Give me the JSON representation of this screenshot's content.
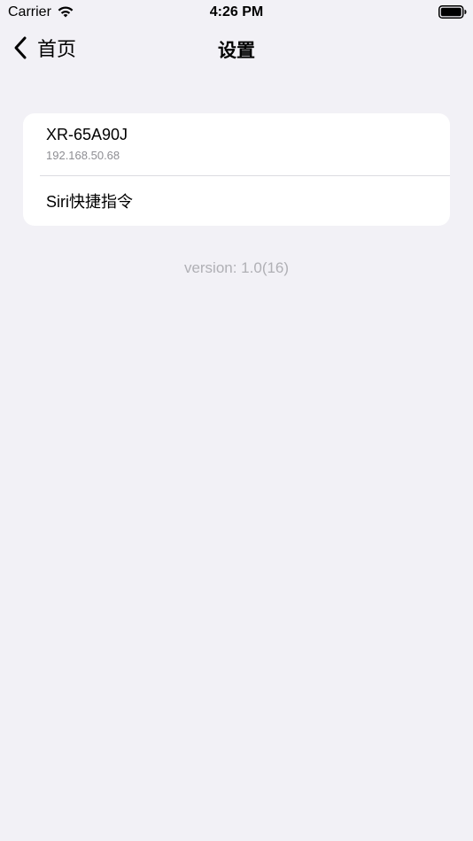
{
  "status_bar": {
    "carrier": "Carrier",
    "time": "4:26 PM",
    "wifi_icon": "wifi-icon",
    "battery_icon": "battery-icon"
  },
  "nav": {
    "back_label": "首页",
    "title": "设置",
    "back_icon": "chevron-left-icon"
  },
  "settings": {
    "device": {
      "name": "XR-65A90J",
      "ip": "192.168.50.68"
    },
    "siri_label": "Siri快捷指令"
  },
  "footer": {
    "version": "version: 1.0(16)"
  },
  "colors": {
    "background": "#f2f1f6",
    "card": "#ffffff",
    "secondary_text": "#8e8e93",
    "version_text": "#b0b0b5"
  }
}
